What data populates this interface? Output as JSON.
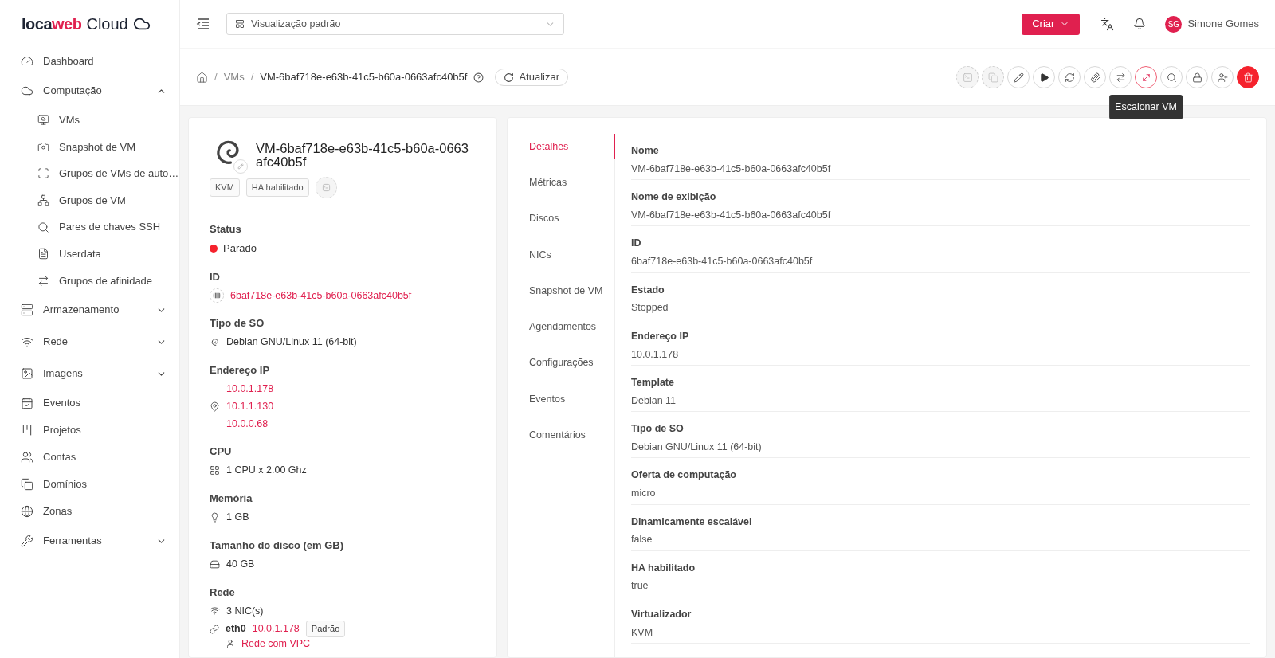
{
  "logo": {
    "brand": "loca",
    "brand_accent": "web",
    "product": "Cloud"
  },
  "sidebar": {
    "items": [
      {
        "label": "Dashboard"
      },
      {
        "label": "Computação",
        "expanded": true,
        "children": [
          {
            "label": "VMs"
          },
          {
            "label": "Snapshot de VM"
          },
          {
            "label": "Grupos de VMs de auto…"
          },
          {
            "label": "Grupos de VM"
          },
          {
            "label": "Pares de chaves SSH"
          },
          {
            "label": "Userdata"
          },
          {
            "label": "Grupos de afinidade"
          }
        ]
      },
      {
        "label": "Armazenamento",
        "expanded": false
      },
      {
        "label": "Rede",
        "expanded": false
      },
      {
        "label": "Imagens",
        "expanded": false
      },
      {
        "label": "Eventos"
      },
      {
        "label": "Projetos"
      },
      {
        "label": "Contas"
      },
      {
        "label": "Domínios"
      },
      {
        "label": "Zonas"
      },
      {
        "label": "Ferramentas",
        "expanded": false
      }
    ]
  },
  "header": {
    "view_select": {
      "value": "Visualização padrão"
    },
    "create_button": "Criar",
    "user": {
      "initials": "SG",
      "name": "Simone Gomes"
    }
  },
  "breadcrumb": {
    "separator": "/",
    "items": [
      "VMs",
      "VM-6baf718e-e63b-41c5-b60a-0663afc40b5f"
    ],
    "refresh_button": "Atualizar"
  },
  "actions": [
    {
      "kind": "terminal",
      "disabled": true,
      "highlighted": false
    },
    {
      "kind": "copy",
      "disabled": true,
      "highlighted": false
    },
    {
      "kind": "edit",
      "disabled": false,
      "highlighted": false
    },
    {
      "kind": "start",
      "disabled": false,
      "highlighted": false
    },
    {
      "kind": "reinstall",
      "disabled": false,
      "highlighted": false
    },
    {
      "kind": "attach",
      "disabled": false,
      "highlighted": false
    },
    {
      "kind": "migrate",
      "disabled": false,
      "highlighted": false
    },
    {
      "kind": "scale",
      "disabled": false,
      "highlighted": true
    },
    {
      "kind": "search",
      "disabled": false,
      "highlighted": false
    },
    {
      "kind": "lock",
      "disabled": false,
      "highlighted": false
    },
    {
      "kind": "user",
      "disabled": false,
      "highlighted": false
    },
    {
      "kind": "delete",
      "disabled": false,
      "highlighted": false
    }
  ],
  "tooltip": "Escalonar VM",
  "summary": {
    "title": "VM-6baf718e-e63b-41c5-b60a-0663afc40b5f",
    "tags": [
      "KVM",
      "HA habilitado"
    ],
    "sections": [
      {
        "label": "Status",
        "kind": "status",
        "value": "Parado",
        "color": "#f5222d"
      },
      {
        "label": "ID",
        "kind": "link",
        "value": "6baf718e-e63b-41c5-b60a-0663afc40b5f"
      },
      {
        "label": "Tipo de SO",
        "kind": "os",
        "value": "Debian GNU/Linux 11 (64-bit)"
      },
      {
        "label": "Endereço IP",
        "kind": "ips",
        "values": [
          "10.0.1.178",
          "10.1.1.130",
          "10.0.0.68"
        ]
      },
      {
        "label": "CPU",
        "kind": "cpu",
        "value": "1 CPU x 2.00 Ghz"
      },
      {
        "label": "Memória",
        "kind": "memory",
        "value": "1 GB"
      },
      {
        "label": "Tamanho do disco (em GB)",
        "kind": "disk",
        "value": "40 GB"
      },
      {
        "label": "Rede",
        "kind": "network",
        "value": "3 NIC(s)",
        "interfaces": [
          {
            "name": "eth0",
            "ip": "10.0.1.178",
            "tag": "Padrão",
            "network": "Rede com VPC"
          }
        ]
      }
    ]
  },
  "tabs": [
    {
      "label": "Detalhes",
      "selected": true
    },
    {
      "label": "Métricas",
      "selected": false
    },
    {
      "label": "Discos",
      "selected": false
    },
    {
      "label": "NICs",
      "selected": false
    },
    {
      "label": "Snapshot de VM",
      "selected": false
    },
    {
      "label": "Agendamentos",
      "selected": false
    },
    {
      "label": "Configurações",
      "selected": false
    },
    {
      "label": "Eventos",
      "selected": false
    },
    {
      "label": "Comentários",
      "selected": false
    }
  ],
  "details": [
    {
      "label": "Nome",
      "value": "VM-6baf718e-e63b-41c5-b60a-0663afc40b5f"
    },
    {
      "label": "Nome de exibição",
      "value": "VM-6baf718e-e63b-41c5-b60a-0663afc40b5f"
    },
    {
      "label": "ID",
      "value": "6baf718e-e63b-41c5-b60a-0663afc40b5f"
    },
    {
      "label": "Estado",
      "value": "Stopped"
    },
    {
      "label": "Endereço IP",
      "value": "10.0.1.178"
    },
    {
      "label": "Template",
      "value": "Debian 11"
    },
    {
      "label": "Tipo de SO",
      "value": "Debian GNU/Linux 11 (64-bit)"
    },
    {
      "label": "Oferta de computação",
      "value": "micro"
    },
    {
      "label": "Dinamicamente escalável",
      "value": "false"
    },
    {
      "label": "HA habilitado",
      "value": "true"
    },
    {
      "label": "Virtualizador",
      "value": "KVM"
    }
  ]
}
